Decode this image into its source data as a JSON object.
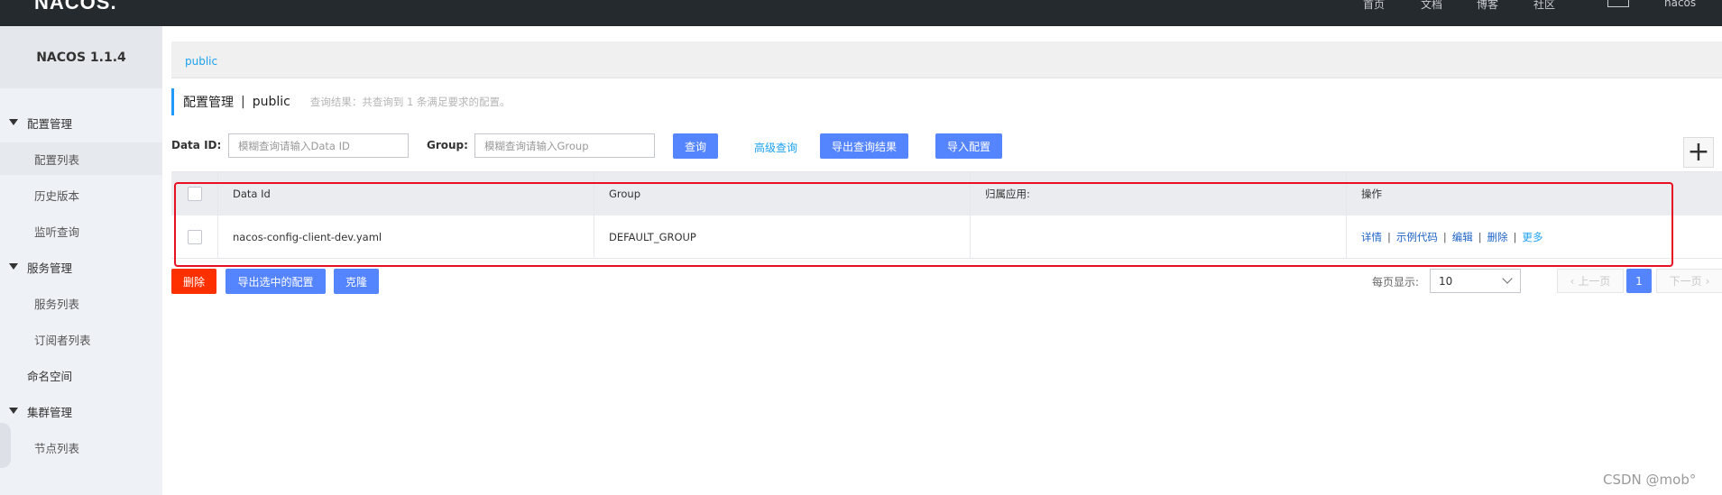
{
  "header": {
    "logo": "NACOS.",
    "nav": [
      "首页",
      "文档",
      "博客",
      "社区"
    ],
    "user": "nacos"
  },
  "sidebar": {
    "brand": "NACOS 1.1.4",
    "items": [
      {
        "label": "配置管理",
        "type": "group"
      },
      {
        "label": "配置列表",
        "type": "sub",
        "active": true
      },
      {
        "label": "历史版本",
        "type": "sub"
      },
      {
        "label": "监听查询",
        "type": "sub"
      },
      {
        "label": "服务管理",
        "type": "group"
      },
      {
        "label": "服务列表",
        "type": "sub"
      },
      {
        "label": "订阅者列表",
        "type": "sub"
      },
      {
        "label": "命名空间",
        "type": "plain"
      },
      {
        "label": "集群管理",
        "type": "group"
      },
      {
        "label": "节点列表",
        "type": "sub"
      }
    ]
  },
  "breadcrumb": {
    "namespace": "public"
  },
  "title": {
    "main": "配置管理",
    "separator": "|",
    "namespace": "public",
    "hint": "查询结果：共查询到 1 条满足要求的配置。"
  },
  "search": {
    "data_id_label": "Data ID:",
    "data_id_placeholder": "模糊查询请输入Data ID",
    "group_label": "Group:",
    "group_placeholder": "模糊查询请输入Group",
    "query_button": "查询",
    "advanced_link": "高级查询",
    "export_button": "导出查询结果",
    "import_button": "导入配置"
  },
  "table": {
    "columns": [
      "Data Id",
      "Group",
      "归属应用:",
      "操作"
    ],
    "rows": [
      {
        "data_id": "nacos-config-client-dev.yaml",
        "group": "DEFAULT_GROUP",
        "app": "",
        "actions": [
          "详情",
          "示例代码",
          "编辑",
          "删除",
          "更多"
        ]
      }
    ]
  },
  "footer": {
    "delete_button": "删除",
    "export_selected_button": "导出选中的配置",
    "clone_button": "克隆",
    "page_size_label": "每页显示:",
    "page_size_value": "10",
    "prev_page": "上一页",
    "current_page": "1",
    "next_page": "下一页"
  },
  "watermark": "CSDN @mob°",
  "colors": {
    "primary": "#5584ff",
    "danger": "#ff3000",
    "link": "#1da1f2",
    "highlight": "#e81123"
  }
}
